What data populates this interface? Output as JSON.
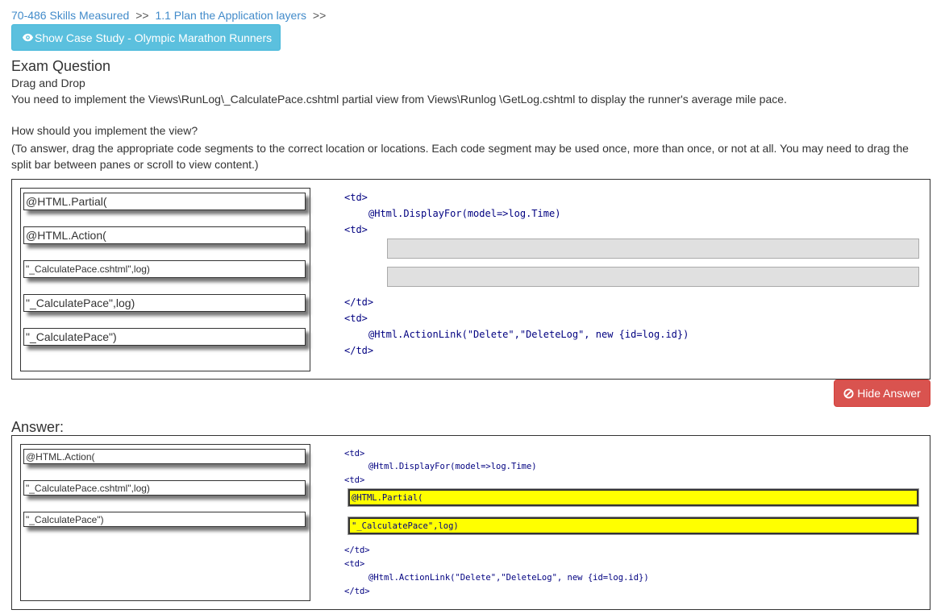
{
  "breadcrumb": {
    "item1": "70-486 Skills Measured",
    "sep1": ">>",
    "item2": "1.1 Plan the Application layers",
    "sep2": ">>"
  },
  "case_study_button": {
    "icon": "eye-icon",
    "label": "Show Case Study - Olympic Marathon Runners"
  },
  "question": {
    "title": "Exam Question",
    "type": "Drag and Drop",
    "text": "You need to implement the Views\\RunLog\\_CalculatePace.cshtml partial view from Views\\Runlog \\GetLog.cshtml to display the runner's average mile pace.",
    "how": "How should you implement the view?",
    "instructions": "(To answer, drag the appropriate code segments to the correct location or locations. Each code segment may be used once, more than once, or not at all. You may need to drag the split bar between panes or scroll to view content.)"
  },
  "segments": [
    "@HTML.Partial(",
    "@HTML.Action(",
    "\"_CalculatePace.cshtml\",log)",
    "\"_CalculatePace\",log)",
    "\"_CalculatePace\")"
  ],
  "code": {
    "td_open_1": "<td>",
    "display_for": "@Html.DisplayFor(model=>log.Time)",
    "td_open_2": "<td>",
    "td_close_1": "</td>",
    "td_open_3": "<td>",
    "action_link": "@Html.ActionLink(\"Delete\",\"DeleteLog\", new {id=log.id})",
    "td_close_2": "</td>"
  },
  "hide_answer_button": {
    "icon": "ban-icon",
    "label": "Hide Answer"
  },
  "answer": {
    "label": "Answer:",
    "remaining_segments": [
      "@HTML.Action(",
      "\"_CalculatePace.cshtml\",log)",
      "\"_CalculatePace\")"
    ],
    "slot1": "@HTML.Partial(",
    "slot2": "\"_CalculatePace\",log)"
  },
  "colors": {
    "link": "#428bca",
    "info_button": "#5bc0de",
    "danger_button": "#d9534f",
    "answer_highlight": "#ffff00",
    "code_text": "#000080"
  }
}
